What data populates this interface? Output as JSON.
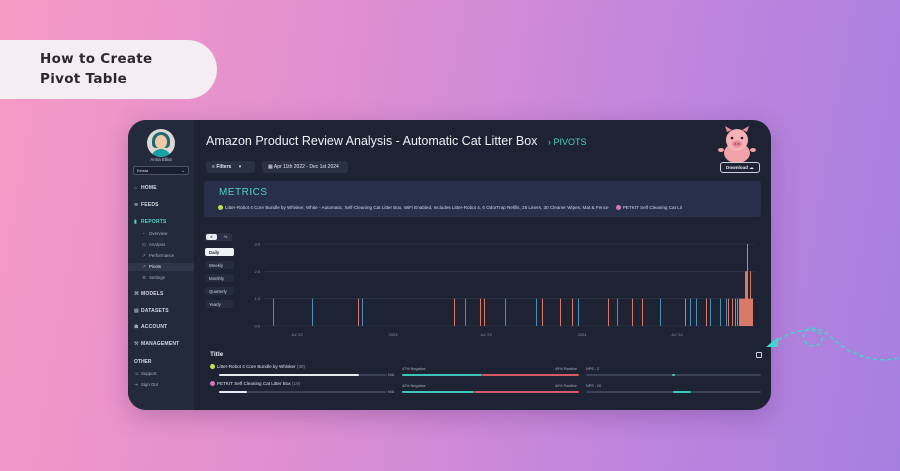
{
  "banner": {
    "line1": "How to Create",
    "line2": "Pivot Table"
  },
  "sidebar": {
    "user_name": "Anna Elliot",
    "org": "Kinsta",
    "nav": [
      {
        "label": "HOME",
        "icon": "home-icon"
      },
      {
        "label": "FEEDS",
        "icon": "feeds-icon"
      },
      {
        "label": "REPORTS",
        "icon": "reports-icon"
      },
      {
        "label": "MODELS",
        "icon": "models-icon"
      },
      {
        "label": "DATASETS",
        "icon": "datasets-icon"
      },
      {
        "label": "ACCOUNT",
        "icon": "account-icon"
      },
      {
        "label": "MANAGEMENT",
        "icon": "management-icon"
      }
    ],
    "reports_sub": [
      "Overview",
      "Analysis",
      "Performance",
      "Pivots",
      "Settings"
    ],
    "other_label": "OTHER",
    "other": [
      "Support",
      "Sign Out"
    ]
  },
  "header": {
    "title": "Amazon Product Review Analysis - Automatic Cat Litter Box",
    "crumb": "PIVOTS",
    "filters": "Filters",
    "date_range": "Apr 11th 2022 - Dec 1st 2024",
    "download": "Download"
  },
  "metrics": {
    "title": "METRICS",
    "legend": [
      {
        "label": "Litter-Robot 4 Core Bundle by Whisker, White - Automatic, Self-Cleaning Cat Litter Box, WiFi Enabled, Includes Litter-Robot 4, 6 OdorTrap Refills, 25 Liners, 30 Cleaner Wipes, Mat & Fence",
        "color": "#c6e04a"
      },
      {
        "label": "PETKIT Self Cleaning Cat Lit",
        "color": "#d07ab8"
      }
    ]
  },
  "controls": {
    "seg_on": "#",
    "seg_off": "%",
    "frequencies": [
      "Daily",
      "Weekly",
      "Monthly",
      "Quarterly",
      "Yearly"
    ],
    "active_frequency": "Daily"
  },
  "chart_data": {
    "type": "bar",
    "y_ticks": [
      "3.0",
      "2.0",
      "1.0",
      "0.0"
    ],
    "x_ticks": [
      "Jul '22",
      "2023",
      "Jul '23",
      "2024",
      "Jul '24"
    ],
    "ylim": [
      0,
      3
    ],
    "series": [
      {
        "color": "#4a8fb8",
        "values": [
          1,
          1,
          1,
          1,
          1,
          1,
          1,
          1,
          1,
          1,
          1,
          1,
          1,
          1
        ]
      },
      {
        "color": "#d97a68",
        "values": [
          1,
          1,
          1,
          1,
          1,
          1,
          1,
          1,
          1,
          1,
          1,
          1,
          1,
          1,
          1,
          1,
          1,
          1,
          1,
          1,
          1,
          1,
          2,
          2,
          3,
          1,
          1,
          2,
          1,
          1
        ]
      }
    ]
  },
  "table": {
    "title": "Title",
    "rows": [
      {
        "name": "Litter-Robot 4 Core Bundle by Whisker",
        "count": "(30)",
        "share": "N/A",
        "neg": "47% Negative",
        "pos": "49% Positive",
        "nps": "NPS : 2",
        "color": "#c6e04a"
      },
      {
        "name": "PETKIT Self Cleaning Cat Litter Box",
        "count": "(19)",
        "share": "N/A",
        "neg": "42% Negative",
        "pos": "40% Positive",
        "nps": "NPS : 20",
        "color": "#d07ab8"
      }
    ]
  }
}
